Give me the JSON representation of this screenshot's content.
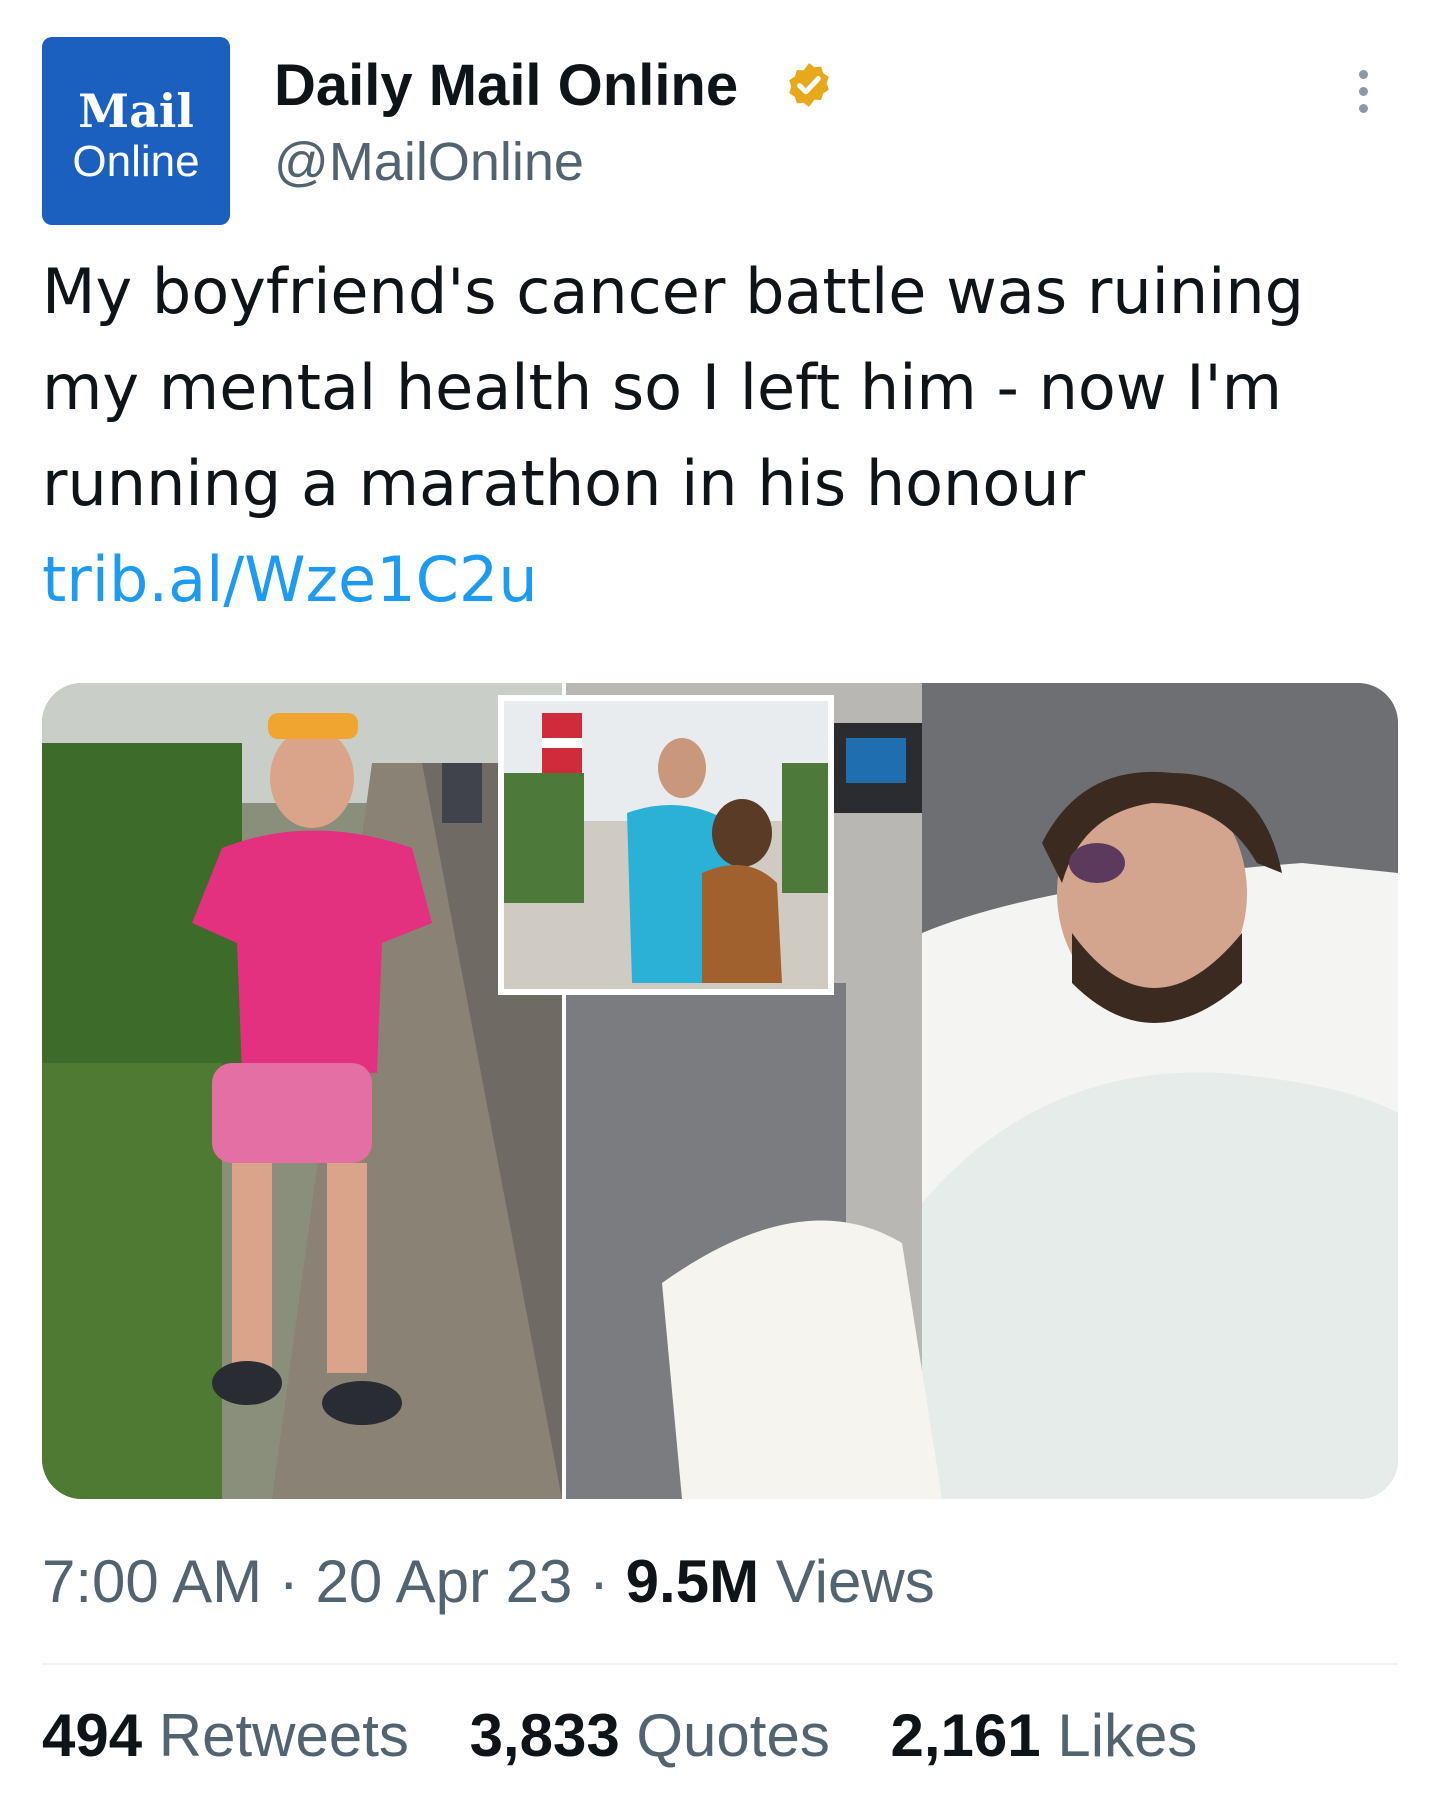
{
  "account": {
    "avatar_line1": "Mail",
    "avatar_line2": "Online",
    "display_name": "Daily Mail Online",
    "handle": "@MailOnline",
    "verified_badge_color": "#e8a81c",
    "brand_color": "#1b5fbf"
  },
  "tweet": {
    "text": "My boyfriend's cancer battle was ruining my mental health so I left him - now I'm running a marathon in his honour ",
    "link_text": "trib.al/Wze1C2u",
    "link_color": "#1d9bf0"
  },
  "media": {
    "description_panels": [
      "woman-in-pink-running-outfit",
      "couple-inset",
      "man-in-hospital-bed"
    ]
  },
  "meta": {
    "time": "7:00 AM",
    "date": "20 Apr 23",
    "views_count": "9.5M",
    "views_label": "Views"
  },
  "stats": {
    "retweets_count": "494",
    "retweets_label": "Retweets",
    "quotes_count": "3,833",
    "quotes_label": "Quotes",
    "likes_count": "2,161",
    "likes_label": "Likes"
  },
  "icons": {
    "more": "more-icon",
    "verified": "verified-icon"
  }
}
